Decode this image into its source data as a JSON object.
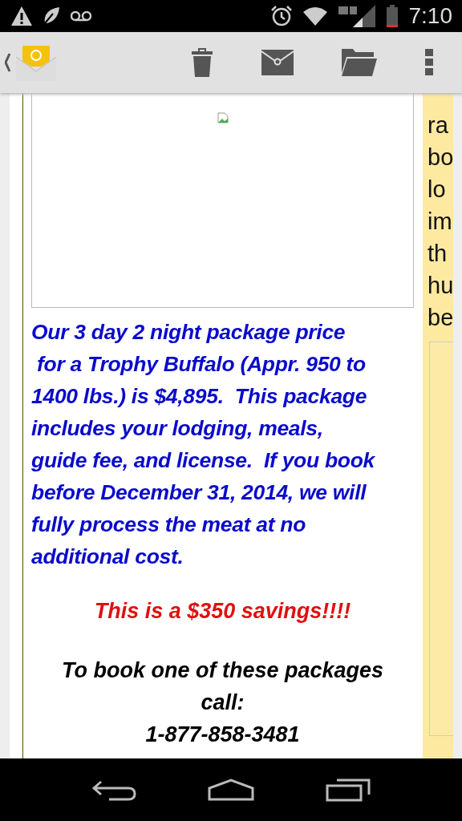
{
  "status_bar": {
    "time": "7:10"
  },
  "action_bar": {
    "actions": [
      {
        "kind": "delete"
      },
      {
        "kind": "mail"
      },
      {
        "kind": "folder"
      },
      {
        "kind": "overflow"
      }
    ]
  },
  "article": {
    "image": {
      "kind": "broken-image"
    },
    "offer_lines": [
      "Our 3 day 2 night package price",
      " for a Trophy Buffalo (Appr. 950 to",
      "1400 lbs.) is $4,895.  This package",
      "includes your lodging, meals,",
      "guide fee, and license.  If you book",
      "before December 31, 2014, we will",
      "fully process the meat at no",
      "additional cost."
    ],
    "savings": "This is a $350 savings!!!!",
    "booking_lines": [
      "To book one of these packages",
      "call:",
      "1-877-858-3481"
    ]
  },
  "side_column": {
    "lines": [
      "ra",
      "bo",
      "lo",
      "im",
      "th",
      "hu",
      "be"
    ]
  }
}
